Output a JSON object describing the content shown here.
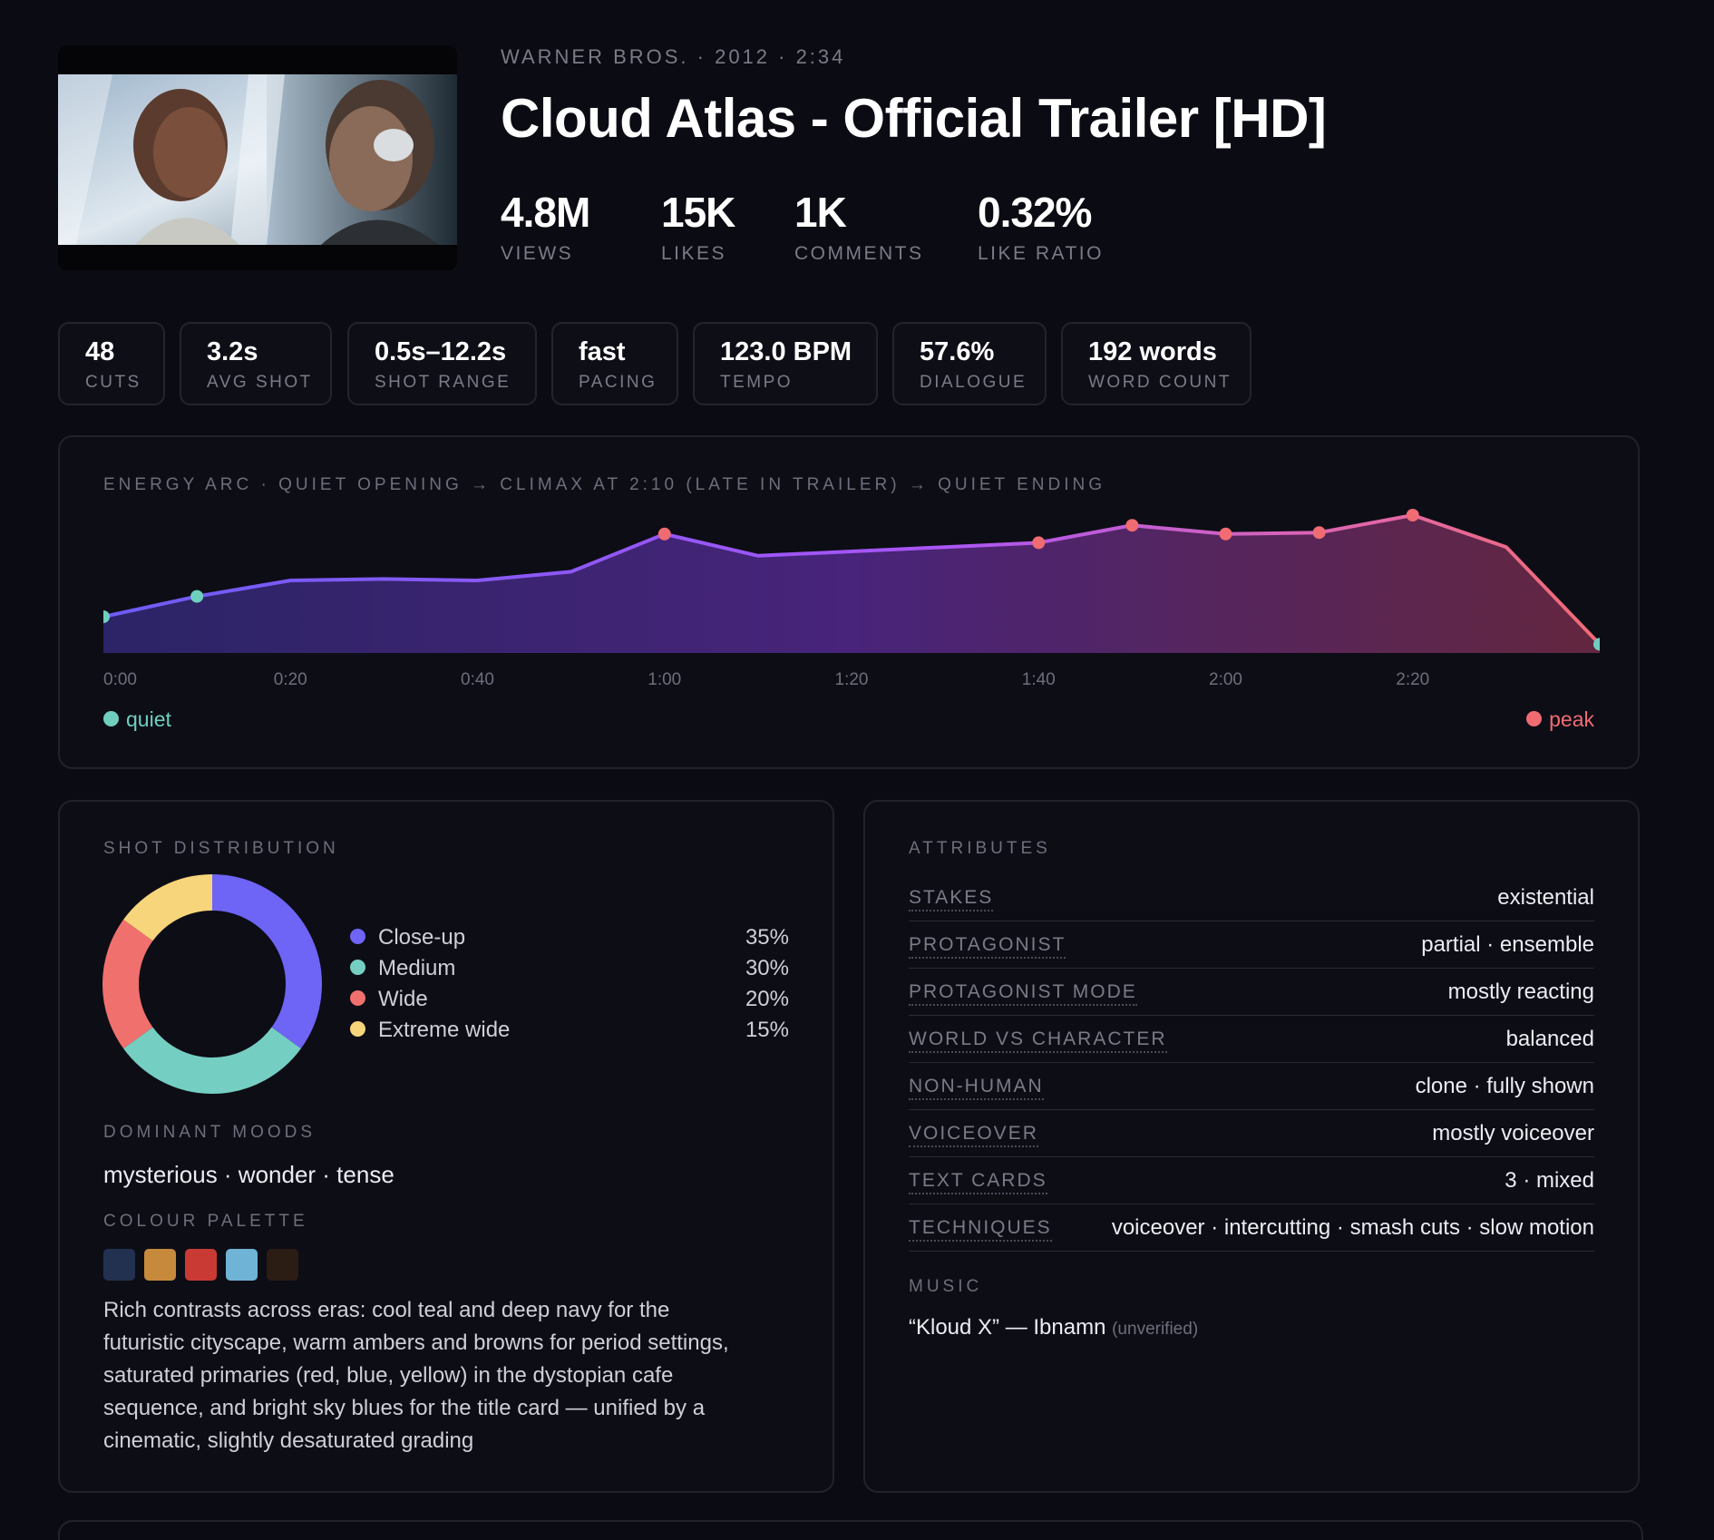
{
  "video": {
    "meta_line": "WARNER BROS. · 2012 · 2:34",
    "title": "Cloud Atlas - Official Trailer [HD]",
    "stats": [
      {
        "value": "4.8M",
        "label": "VIEWS"
      },
      {
        "value": "15K",
        "label": "LIKES"
      },
      {
        "value": "1K",
        "label": "COMMENTS"
      },
      {
        "value": "0.32%",
        "label": "LIKE RATIO"
      }
    ]
  },
  "metrics": [
    {
      "value": "48",
      "label": "CUTS"
    },
    {
      "value": "3.2s",
      "label": "AVG SHOT"
    },
    {
      "value": "0.5s–12.2s",
      "label": "SHOT RANGE"
    },
    {
      "value": "fast",
      "label": "PACING"
    },
    {
      "value": "123.0 BPM",
      "label": "TEMPO"
    },
    {
      "value": "57.6%",
      "label": "DIALOGUE"
    },
    {
      "value": "192 words",
      "label": "WORD COUNT"
    }
  ],
  "energy": {
    "caption": "ENERGY ARC · QUIET OPENING → CLIMAX AT 2:10 (LATE IN TRAILER) → QUIET ENDING",
    "legend_quiet": "quiet",
    "legend_peak": "peak",
    "colors": {
      "quiet": "#6fcfbf",
      "peak": "#f06b72",
      "mid": "#a855f7"
    }
  },
  "chart_data": {
    "type": "area",
    "x_ticks": [
      "0:00",
      "0:20",
      "0:40",
      "1:00",
      "1:20",
      "1:40",
      "2:00",
      "2:20"
    ],
    "xlim": [
      0,
      150
    ],
    "ylim": [
      0,
      1
    ],
    "points": [
      {
        "x": 0,
        "y": 0.25,
        "marker": "quiet"
      },
      {
        "x": 10,
        "y": 0.39,
        "marker": "quiet"
      },
      {
        "x": 20,
        "y": 0.5
      },
      {
        "x": 30,
        "y": 0.51
      },
      {
        "x": 40,
        "y": 0.5
      },
      {
        "x": 50,
        "y": 0.56
      },
      {
        "x": 60,
        "y": 0.82,
        "marker": "peak"
      },
      {
        "x": 70,
        "y": 0.67
      },
      {
        "x": 80,
        "y": 0.7
      },
      {
        "x": 90,
        "y": 0.73
      },
      {
        "x": 100,
        "y": 0.76,
        "marker": "peak"
      },
      {
        "x": 110,
        "y": 0.88,
        "marker": "peak"
      },
      {
        "x": 120,
        "y": 0.82,
        "marker": "peak"
      },
      {
        "x": 130,
        "y": 0.83,
        "marker": "peak"
      },
      {
        "x": 140,
        "y": 0.95,
        "marker": "peak"
      },
      {
        "x": 150,
        "y": 0.73
      },
      {
        "x": 160,
        "y": 0.06,
        "marker": "quiet"
      }
    ]
  },
  "shots": {
    "label": "SHOT DISTRIBUTION",
    "items": [
      {
        "name": "Close-up",
        "pct": "35%",
        "value": 35,
        "color": "#6e64f5"
      },
      {
        "name": "Medium",
        "pct": "30%",
        "value": 30,
        "color": "#74cfc2"
      },
      {
        "name": "Wide",
        "pct": "20%",
        "value": 20,
        "color": "#f0706e"
      },
      {
        "name": "Extreme wide",
        "pct": "15%",
        "value": 15,
        "color": "#f7d57a"
      }
    ]
  },
  "moods": {
    "label": "DOMINANT MOODS",
    "text": "mysterious · wonder · tense"
  },
  "palette": {
    "label": "COLOUR PALETTE",
    "colors": [
      "#22314f",
      "#c78a3c",
      "#c93a34",
      "#6fb4d6",
      "#2b1c14"
    ],
    "description_lines": [
      "Rich contrasts across eras: cool teal and deep navy for the",
      "futuristic cityscape, warm ambers and browns for period settings,",
      "saturated primaries (red, blue, yellow) in the dystopian cafe",
      "sequence, and bright sky blues for the title card — unified by a",
      "cinematic, slightly desaturated grading"
    ]
  },
  "attributes": {
    "label": "ATTRIBUTES",
    "rows": [
      {
        "key": "STAKES",
        "value": "existential"
      },
      {
        "key": "PROTAGONIST",
        "value": "partial · ensemble"
      },
      {
        "key": "PROTAGONIST MODE",
        "value": "mostly reacting"
      },
      {
        "key": "WORLD VS CHARACTER",
        "value": "balanced"
      },
      {
        "key": "NON-HUMAN",
        "value": "clone · fully shown"
      },
      {
        "key": "VOICEOVER",
        "value": "mostly voiceover"
      },
      {
        "key": "TEXT CARDS",
        "value": "3 · mixed"
      },
      {
        "key": "TECHNIQUES",
        "value": "voiceover · intercutting · smash cuts · slow motion"
      }
    ],
    "music_label": "MUSIC",
    "music_track": "“Kloud X” — Ibnamn",
    "music_note": "(unverified)"
  }
}
